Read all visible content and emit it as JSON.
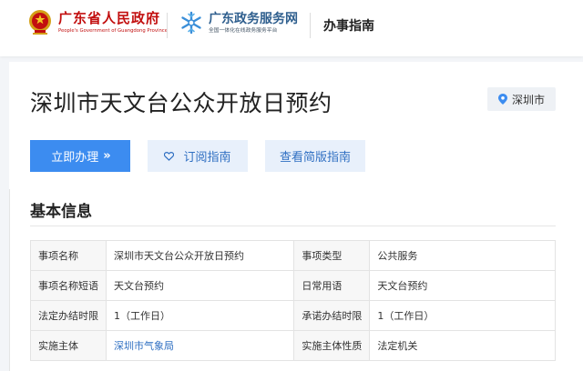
{
  "header": {
    "gov_name": "广东省人民政府",
    "gov_name_en": "People's Government of Guangdong Province",
    "service_name": "广东政务服务网",
    "service_tagline": "全国一体化在线政务服务平台",
    "section": "办事指南",
    "colors": {
      "gov_red": "#c20f0f",
      "service_blue": "#2f5f8e"
    }
  },
  "page": {
    "title": "深圳市天文台公众开放日预约",
    "location": "深圳市"
  },
  "actions": {
    "apply_label": "立即办理",
    "apply_arrows": "»",
    "subscribe_label": "订阅指南",
    "simple_label": "查看简版指南",
    "colors": {
      "primary": "#3c8cf0",
      "secondary_bg": "#e8f0fb",
      "secondary_text": "#2f6fc2"
    }
  },
  "basic_info": {
    "title": "基本信息",
    "rows": [
      {
        "label1": "事项名称",
        "value1": "深圳市天文台公众开放日预约",
        "label2": "事项类型",
        "value2": "公共服务"
      },
      {
        "label1": "事项名称短语",
        "value1": "天文台预约",
        "label2": "日常用语",
        "value2": "天文台预约"
      },
      {
        "label1": "法定办结时限",
        "value1": "1（工作日）",
        "label2": "承诺办结时限",
        "value2": "1（工作日）"
      },
      {
        "label1": "实施主体",
        "value1": "深圳市气象局",
        "label2": "实施主体性质",
        "value2": "法定机关"
      }
    ]
  }
}
